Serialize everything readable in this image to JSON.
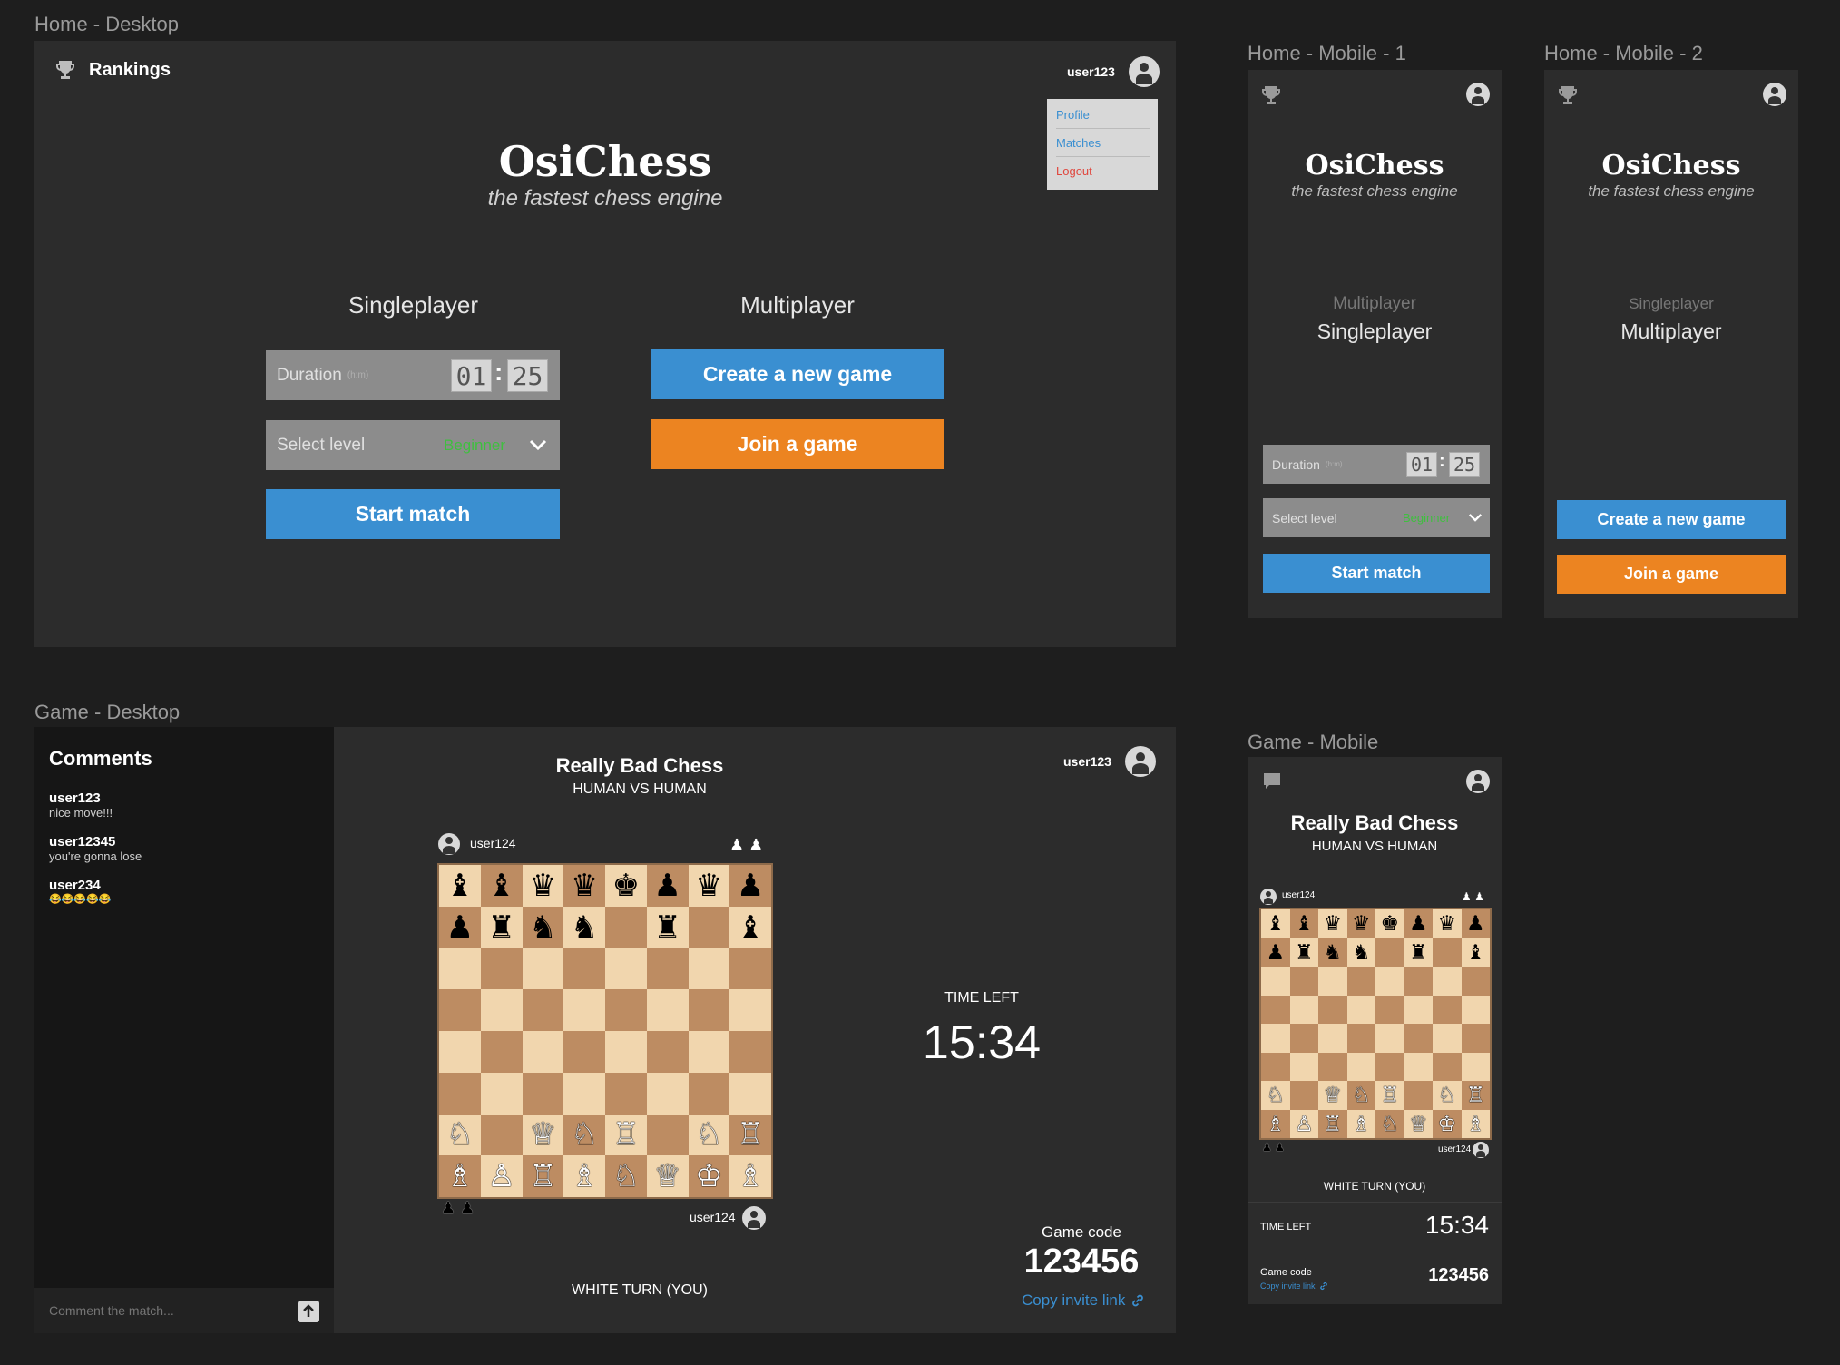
{
  "labels": {
    "home_desktop": "Home - Desktop",
    "home_mobile_1": "Home - Mobile - 1",
    "home_mobile_2": "Home - Mobile - 2",
    "game_desktop": "Game - Desktop",
    "game_mobile": "Game - Mobile"
  },
  "brand": {
    "title": "OsiChess",
    "subtitle": "the fastest chess engine"
  },
  "nav": {
    "rankings": "Rankings",
    "username": "user123",
    "menu": [
      "Profile",
      "Matches",
      "Logout"
    ]
  },
  "singleplayer": {
    "heading": "Singleplayer",
    "duration_label": "Duration",
    "duration_unit": "(h:m)",
    "hours": "01",
    "minutes": "25",
    "separator": ":",
    "level_label": "Select level",
    "level_value": "Beginner",
    "start_button": "Start match"
  },
  "multiplayer": {
    "heading": "Multiplayer",
    "create_button": "Create a new game",
    "join_button": "Join a game"
  },
  "game": {
    "title": "Really Bad Chess",
    "subtitle": "HUMAN VS HUMAN",
    "username": "user123",
    "opponent": "user124",
    "self": "user124",
    "turn": "WHITE TURN (YOU)",
    "time_left_label": "TIME LEFT",
    "time_left_mobile_label": "TIME LEFT",
    "time_left": "15:34",
    "game_code_label": "Game code",
    "game_code": "123456",
    "copy_link": "Copy invite link",
    "captured_black": "♟ ♟",
    "captured_white": "♟ ♟"
  },
  "comments": {
    "heading": "Comments",
    "items": [
      {
        "user": "user123",
        "text": "nice move!!!"
      },
      {
        "user": "user12345",
        "text": "you're gonna lose"
      },
      {
        "user": "user234",
        "text": "😂😂😂😂😂"
      }
    ],
    "input_placeholder": "Comment the match..."
  },
  "board": [
    [
      "♝",
      "♝",
      "♛",
      "♛",
      "♚",
      "♟",
      "♛",
      "♟"
    ],
    [
      "♟",
      "♜",
      "♞",
      "♞",
      "",
      "♜",
      "",
      "♝"
    ],
    [
      "",
      "",
      "",
      "",
      "",
      "",
      "",
      ""
    ],
    [
      "",
      "",
      "",
      "",
      "",
      "",
      "",
      ""
    ],
    [
      "",
      "",
      "",
      "",
      "",
      "",
      "",
      ""
    ],
    [
      "",
      "",
      "",
      "",
      "",
      "",
      "",
      ""
    ],
    [
      "♘",
      "",
      "♕",
      "♘",
      "♖",
      "",
      "♘",
      "♖"
    ],
    [
      "♗",
      "♙",
      "♖",
      "♗",
      "♘",
      "♕",
      "♔",
      "♗"
    ]
  ],
  "colors": {
    "background": "#1e1e1e",
    "panel": "#2c2c2c",
    "blue": "#3a8fd1",
    "orange": "#ec8421",
    "light_square": "#f1d6ae",
    "dark_square": "#bd8c62",
    "level_green": "#3fbf3f",
    "logout_red": "#e0463d",
    "link_blue": "#3a8fd1"
  },
  "icons": {
    "rankings": "trophy-icon",
    "user": "user-avatar-icon",
    "chat": "chat-icon",
    "send": "arrow-up-icon",
    "link": "link-icon",
    "dropdown": "chevron-down-icon"
  }
}
